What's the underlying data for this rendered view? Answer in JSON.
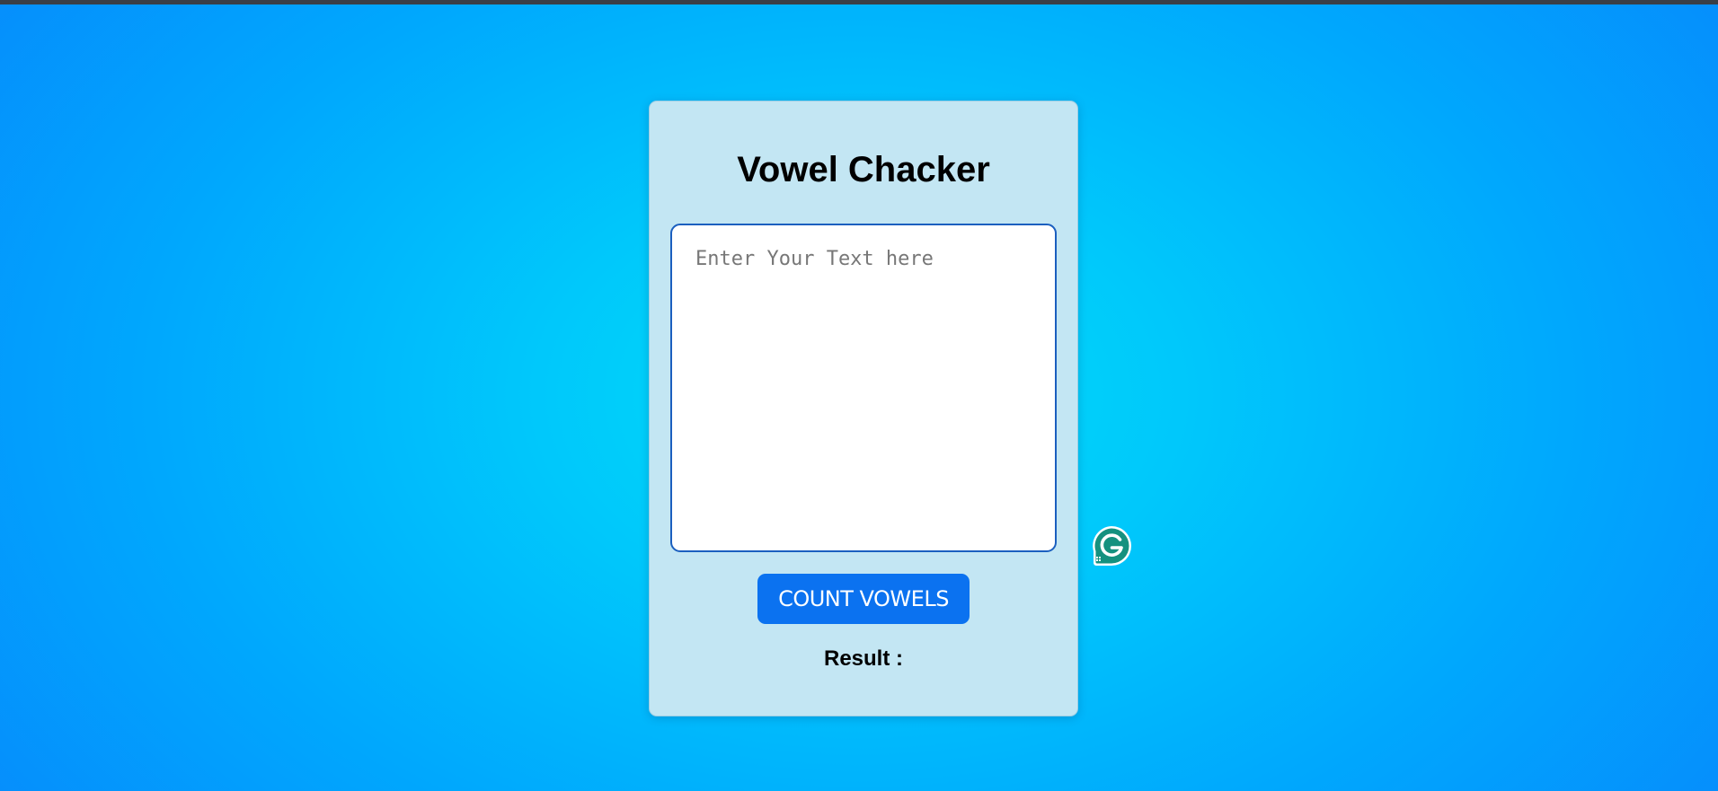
{
  "app": {
    "title": "Vowel Chacker"
  },
  "input": {
    "value": "",
    "placeholder": "Enter Your Text here"
  },
  "button": {
    "label": "COUNT VOWELS"
  },
  "result": {
    "label": "Result :"
  },
  "widgets": {
    "grammarly_icon": "grammarly-g-icon"
  },
  "colors": {
    "card_background": "#c3e6f3",
    "button_background": "#0b72f0",
    "input_border": "#1b5fbf",
    "grammarly_green": "#15917f"
  }
}
